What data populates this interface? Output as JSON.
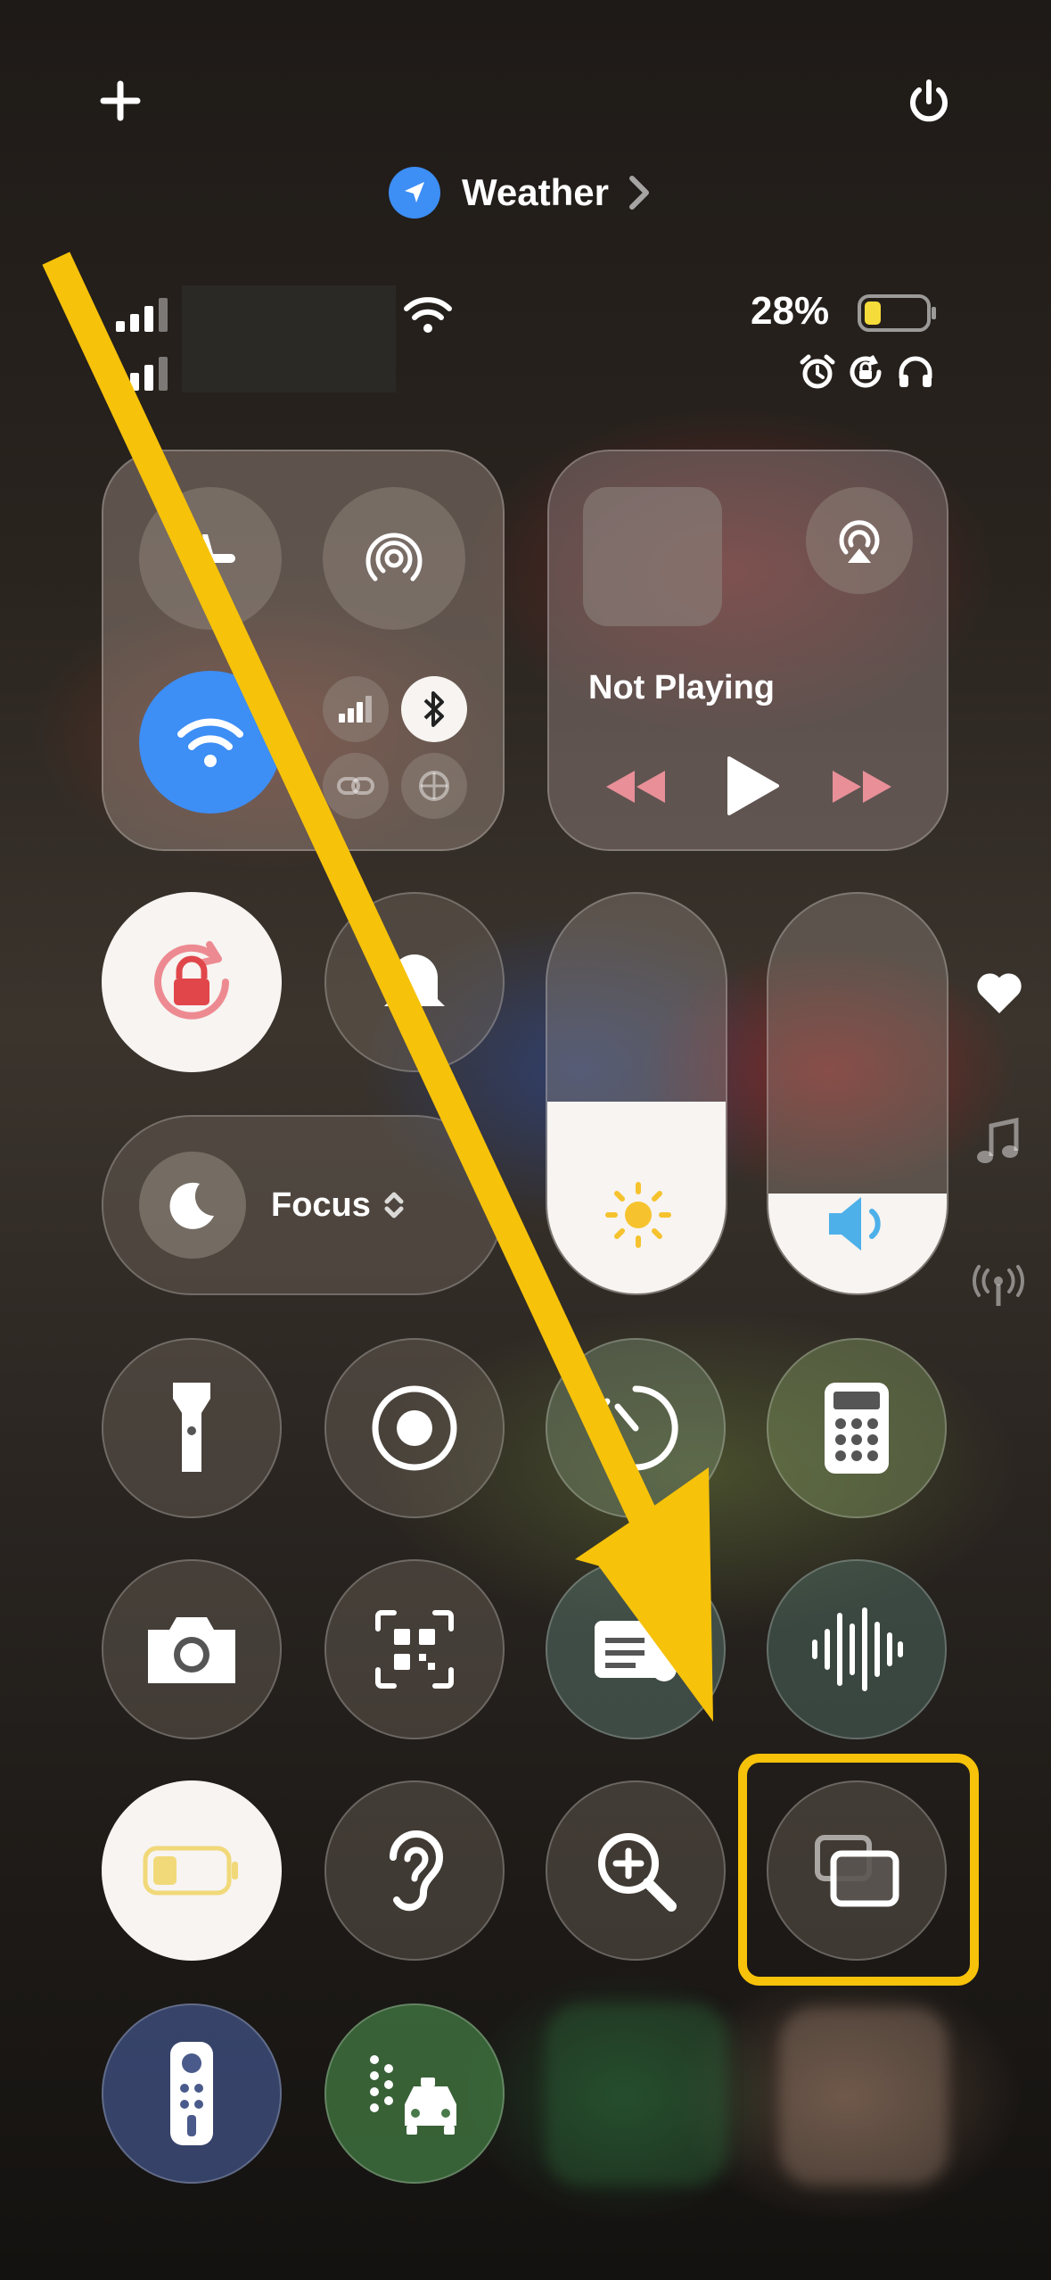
{
  "header": {
    "add_icon": "plus-icon",
    "power_icon": "power-icon",
    "location_app_label": "Weather"
  },
  "status": {
    "battery_percent": "28%",
    "battery_level": 0.28,
    "status_icons": [
      "alarm-icon",
      "rotation-lock-icon",
      "headphones-icon"
    ]
  },
  "now_playing": {
    "label": "Not Playing"
  },
  "focus": {
    "label": "Focus"
  },
  "controls": [
    "airplane-mode",
    "airdrop",
    "wifi",
    "cellular",
    "bluetooth",
    "hotspot",
    "vpn",
    "orientation-lock",
    "silent-mode",
    "brightness",
    "volume",
    "flashlight",
    "screen-record",
    "timer",
    "calculator",
    "camera",
    "qr-scanner",
    "wallet",
    "voice-memos",
    "low-power-mode",
    "hearing",
    "magnifier",
    "screen-mirroring",
    "apple-tv-remote",
    "driving-focus"
  ],
  "sliders": {
    "brightness_level": 0.48,
    "volume_level": 0.25
  },
  "colors": {
    "accent_blue": "#3d8ef5",
    "arrow_yellow": "#f6c20a",
    "highlight_yellow": "#f6c20a",
    "red": "#e0464a",
    "sun": "#f6c32f"
  }
}
